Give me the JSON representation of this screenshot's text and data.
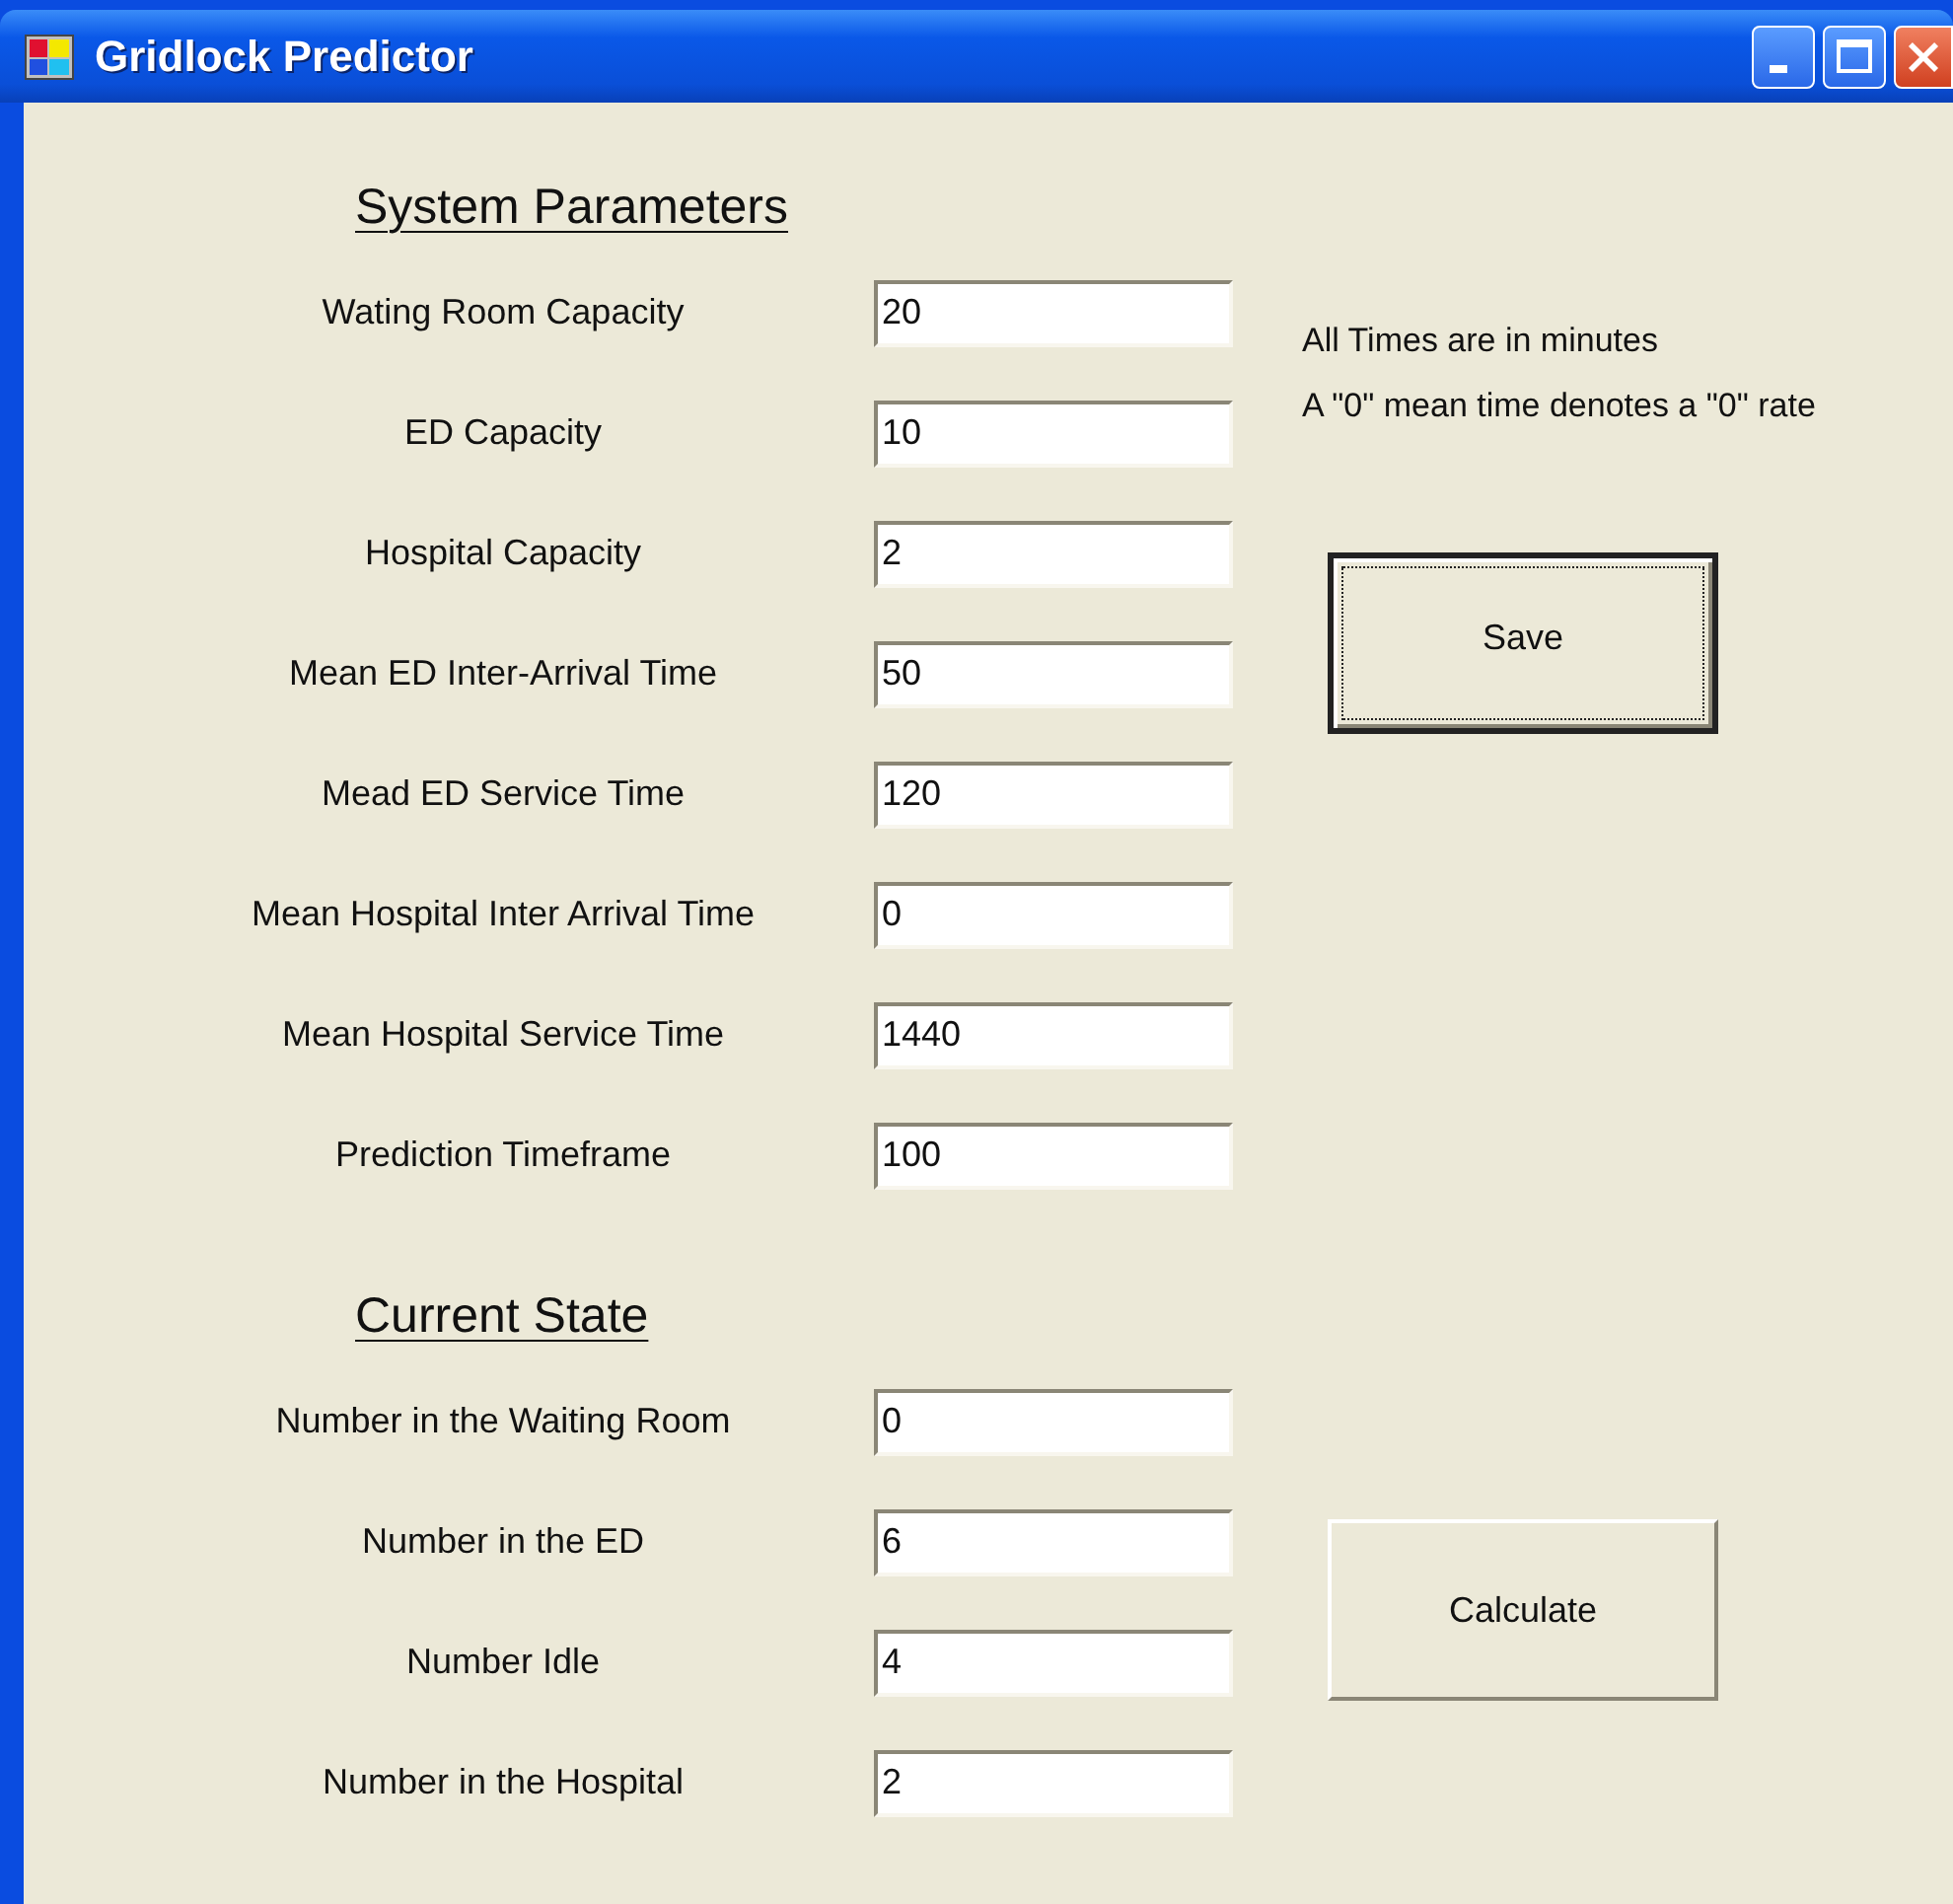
{
  "window": {
    "title": "Gridlock Predictor"
  },
  "sections": [
    {
      "title": "System Parameters",
      "fields": [
        {
          "label": "Wating Room Capacity",
          "value": "20"
        },
        {
          "label": "ED Capacity",
          "value": "10"
        },
        {
          "label": "Hospital Capacity",
          "value": "2"
        },
        {
          "label": "Mean ED Inter-Arrival Time",
          "value": "50"
        },
        {
          "label": "Mead ED Service Time",
          "value": "120"
        },
        {
          "label": "Mean Hospital Inter Arrival Time",
          "value": "0"
        },
        {
          "label": "Mean Hospital Service Time",
          "value": "1440"
        },
        {
          "label": "Prediction Timeframe",
          "value": "100"
        }
      ]
    },
    {
      "title": "Current State",
      "fields": [
        {
          "label": "Number in the Waiting Room",
          "value": "0"
        },
        {
          "label": "Number in the ED",
          "value": "6"
        },
        {
          "label": "Number Idle",
          "value": "4"
        },
        {
          "label": "Number in the Hospital",
          "value": "2"
        }
      ]
    }
  ],
  "notes": [
    "All Times are in minutes",
    "A \"0\" mean time denotes a \"0\" rate"
  ],
  "buttons": [
    {
      "label": "Save",
      "focused": true
    },
    {
      "label": "Calculate",
      "focused": false
    }
  ]
}
